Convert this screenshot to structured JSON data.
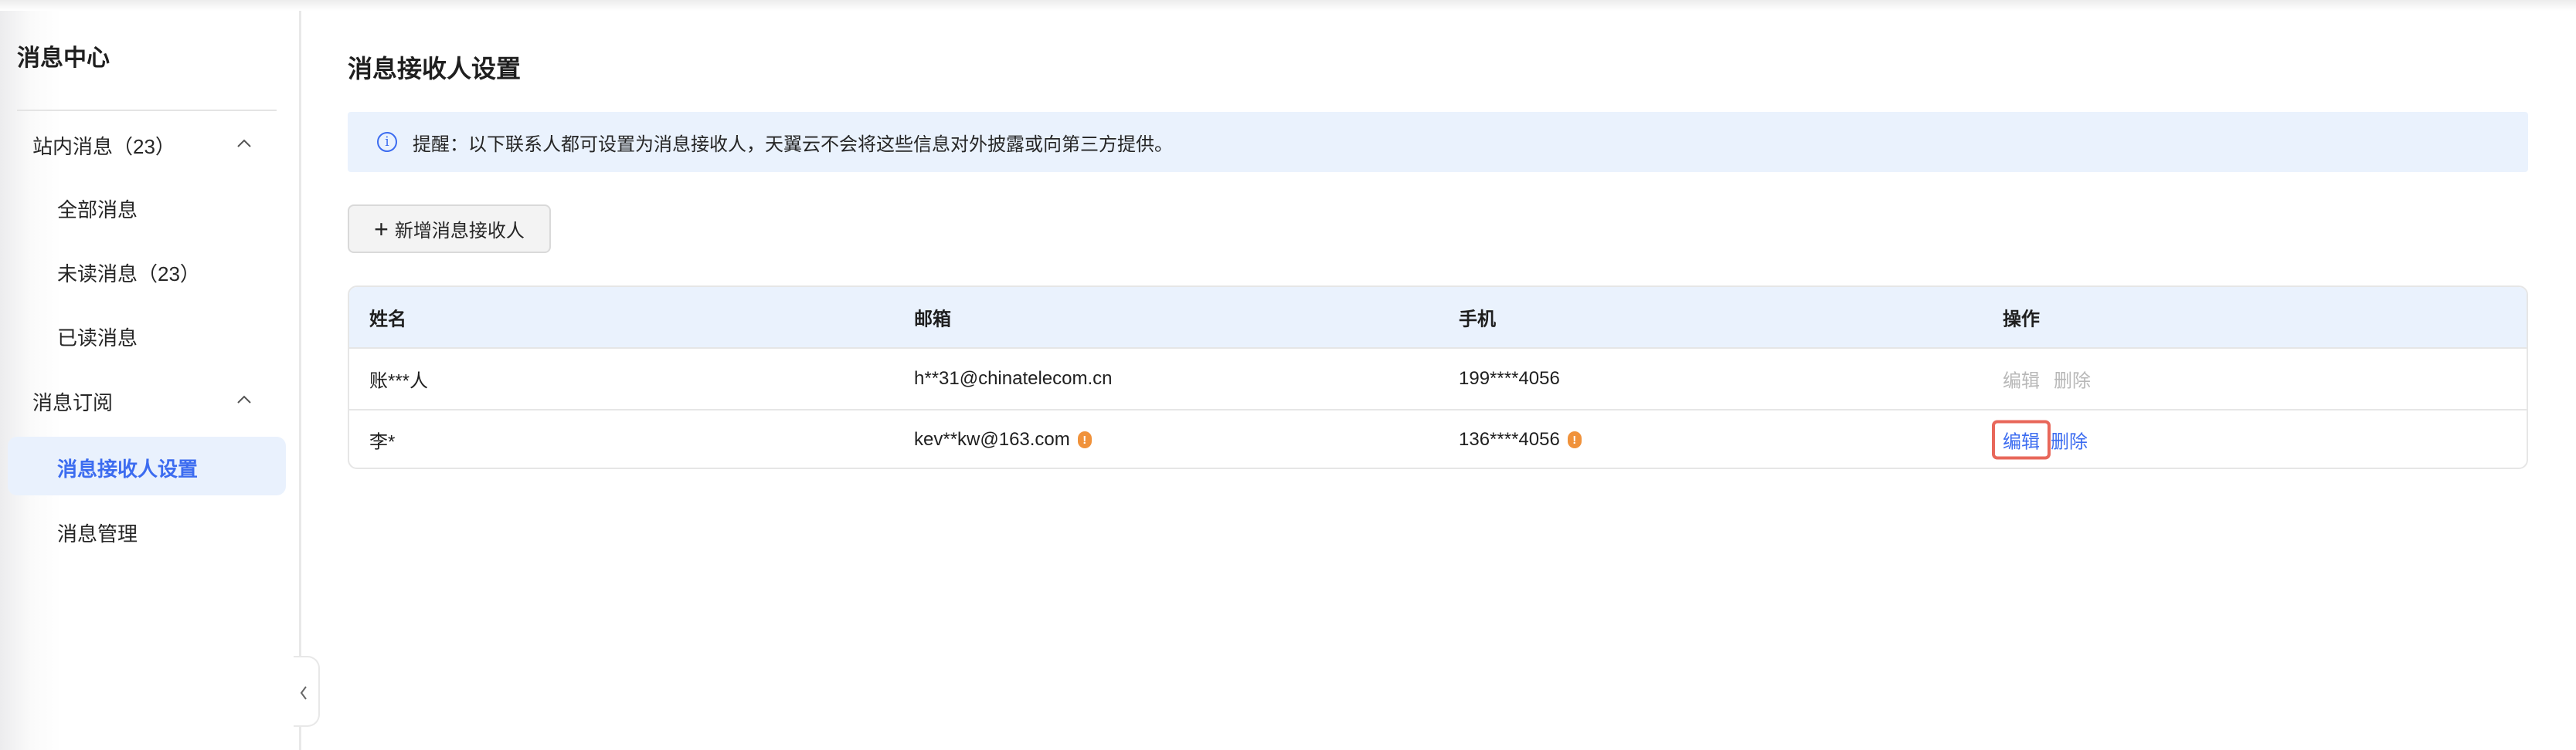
{
  "sidebar": {
    "title": "消息中心",
    "groups": [
      {
        "label": "站内消息（23）",
        "items": [
          "全部消息",
          "未读消息（23）",
          "已读消息"
        ]
      },
      {
        "label": "消息订阅",
        "items": [
          "消息接收人设置",
          "消息管理"
        ]
      }
    ],
    "active": "消息接收人设置"
  },
  "main": {
    "title": "消息接收人设置",
    "alert": "提醒：以下联系人都可设置为消息接收人，天翼云不会将这些信息对外披露或向第三方提供。",
    "add_button": "新增消息接收人",
    "table": {
      "headers": [
        "姓名",
        "邮箱",
        "手机",
        "操作"
      ],
      "rows": [
        {
          "name": "账***人",
          "email": "h**31@chinatelecom.cn",
          "email_warn": false,
          "phone": "199****4056",
          "phone_warn": false,
          "edit": "编辑",
          "delete": "删除",
          "actions_enabled": false
        },
        {
          "name": "李*",
          "email": "kev**kw@163.com",
          "email_warn": true,
          "phone": "136****4056",
          "phone_warn": true,
          "edit": "编辑",
          "delete": "删除",
          "actions_enabled": true
        }
      ]
    }
  },
  "colors": {
    "accent": "#3c6cf0",
    "warning": "#f0923b",
    "highlight": "#e8675a",
    "alert_bg": "#eaf2fd"
  }
}
